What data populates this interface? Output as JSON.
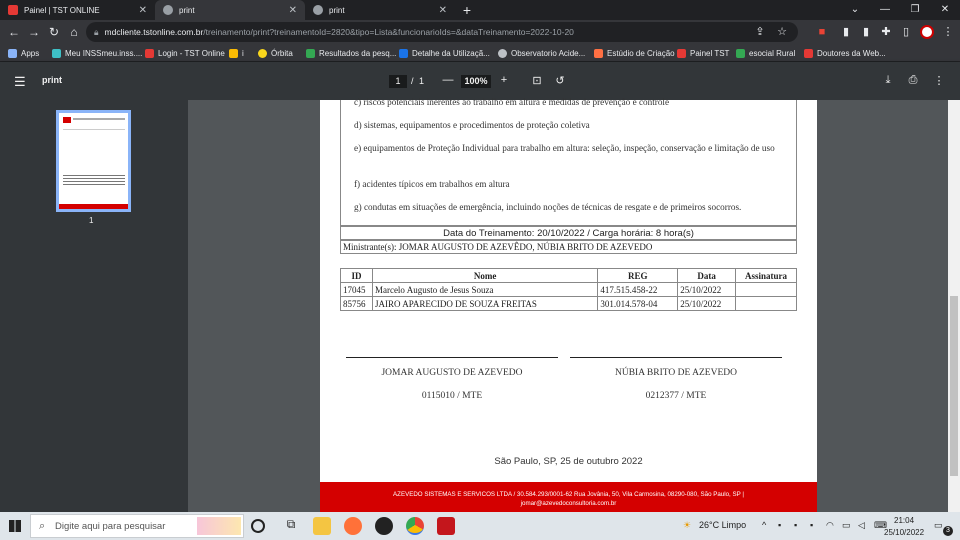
{
  "browser": {
    "tabs": [
      {
        "title": "Painel | TST ONLINE",
        "active": false
      },
      {
        "title": "print",
        "active": true
      },
      {
        "title": "print",
        "active": false
      }
    ],
    "url_host": "mdcliente.tstonline.com.br",
    "url_path": "/treinamento/print?treinamentoId=2820&tipo=Lista&funcionarioIds=&dataTreinamento=2022-10-20",
    "bookmarks": [
      "Apps",
      "Meu INSSmeu.inss....",
      "Login - TST Online",
      "i",
      "Órbita",
      "Resultados da pesq...",
      "Detalhe da Utilizaçã...",
      "Observatorio Acide...",
      "Estúdio de Criação",
      "Painel TST",
      "esocial Rural",
      "Doutores da Web..."
    ]
  },
  "pdf_viewer": {
    "title": "print",
    "page_current": "1",
    "page_separator": "/",
    "page_total": "1",
    "zoom": "100%",
    "thumbnail_label": "1"
  },
  "document": {
    "topics": [
      "c) riscos potenciais inerentes ao trabalho em altura e medidas de prevenção e controle",
      "d) sistemas, equipamentos e procedimentos de proteção coletiva",
      "e) equipamentos de Proteção Individual para trabalho em altura: seleção, inspeção, conservação e limitação de uso",
      "f) acidentes típicos em trabalhos em altura",
      "g) condutas em situações de emergência, incluindo noções de técnicas de resgate e de primeiros socorros."
    ],
    "training_date": "Data do Treinamento: 20/10/2022 / Carga horária: 8 hora(s)",
    "instructors": "Ministrante(s): JOMAR AUGUSTO DE AZEVÊDO, NÚBIA BRITO DE AZEVEDO",
    "table": {
      "headers": [
        "ID",
        "Nome",
        "REG",
        "Data",
        "Assinatura"
      ],
      "rows": [
        [
          "17045",
          "Marcelo Augusto de Jesus Souza",
          "417.515.458-22",
          "25/10/2022",
          ""
        ],
        [
          "85756",
          "JAIRO APARECIDO DE SOUZA FREITAS",
          "301.014.578-04",
          "25/10/2022",
          ""
        ]
      ]
    },
    "signatures": [
      {
        "name": "JOMAR AUGUSTO DE AZEVEDO",
        "registry": "0115010 / MTE"
      },
      {
        "name": "NÚBIA BRITO DE AZEVEDO",
        "registry": "0212377 / MTE"
      }
    ],
    "place_date": "São Paulo, SP, 25 de outubro 2022",
    "footer_line1": "AZEVEDO SISTEMAS E SERVICOS LTDA / 30.584.293/0001-62 Rua Jovânia, 50, Vila Carmosina, 08290-080, São Paulo, SP |",
    "footer_line2": "jomar@azevedoconsultoria.com.br"
  },
  "taskbar": {
    "search_placeholder": "Digite aqui para pesquisar",
    "weather": "26°C  Limpo",
    "time": "21:04",
    "date": "25/10/2022",
    "notification_count": "3"
  },
  "colors": {
    "accent_red": "#d40000",
    "chrome_dark": "#202124",
    "pdf_bar": "#323639"
  }
}
